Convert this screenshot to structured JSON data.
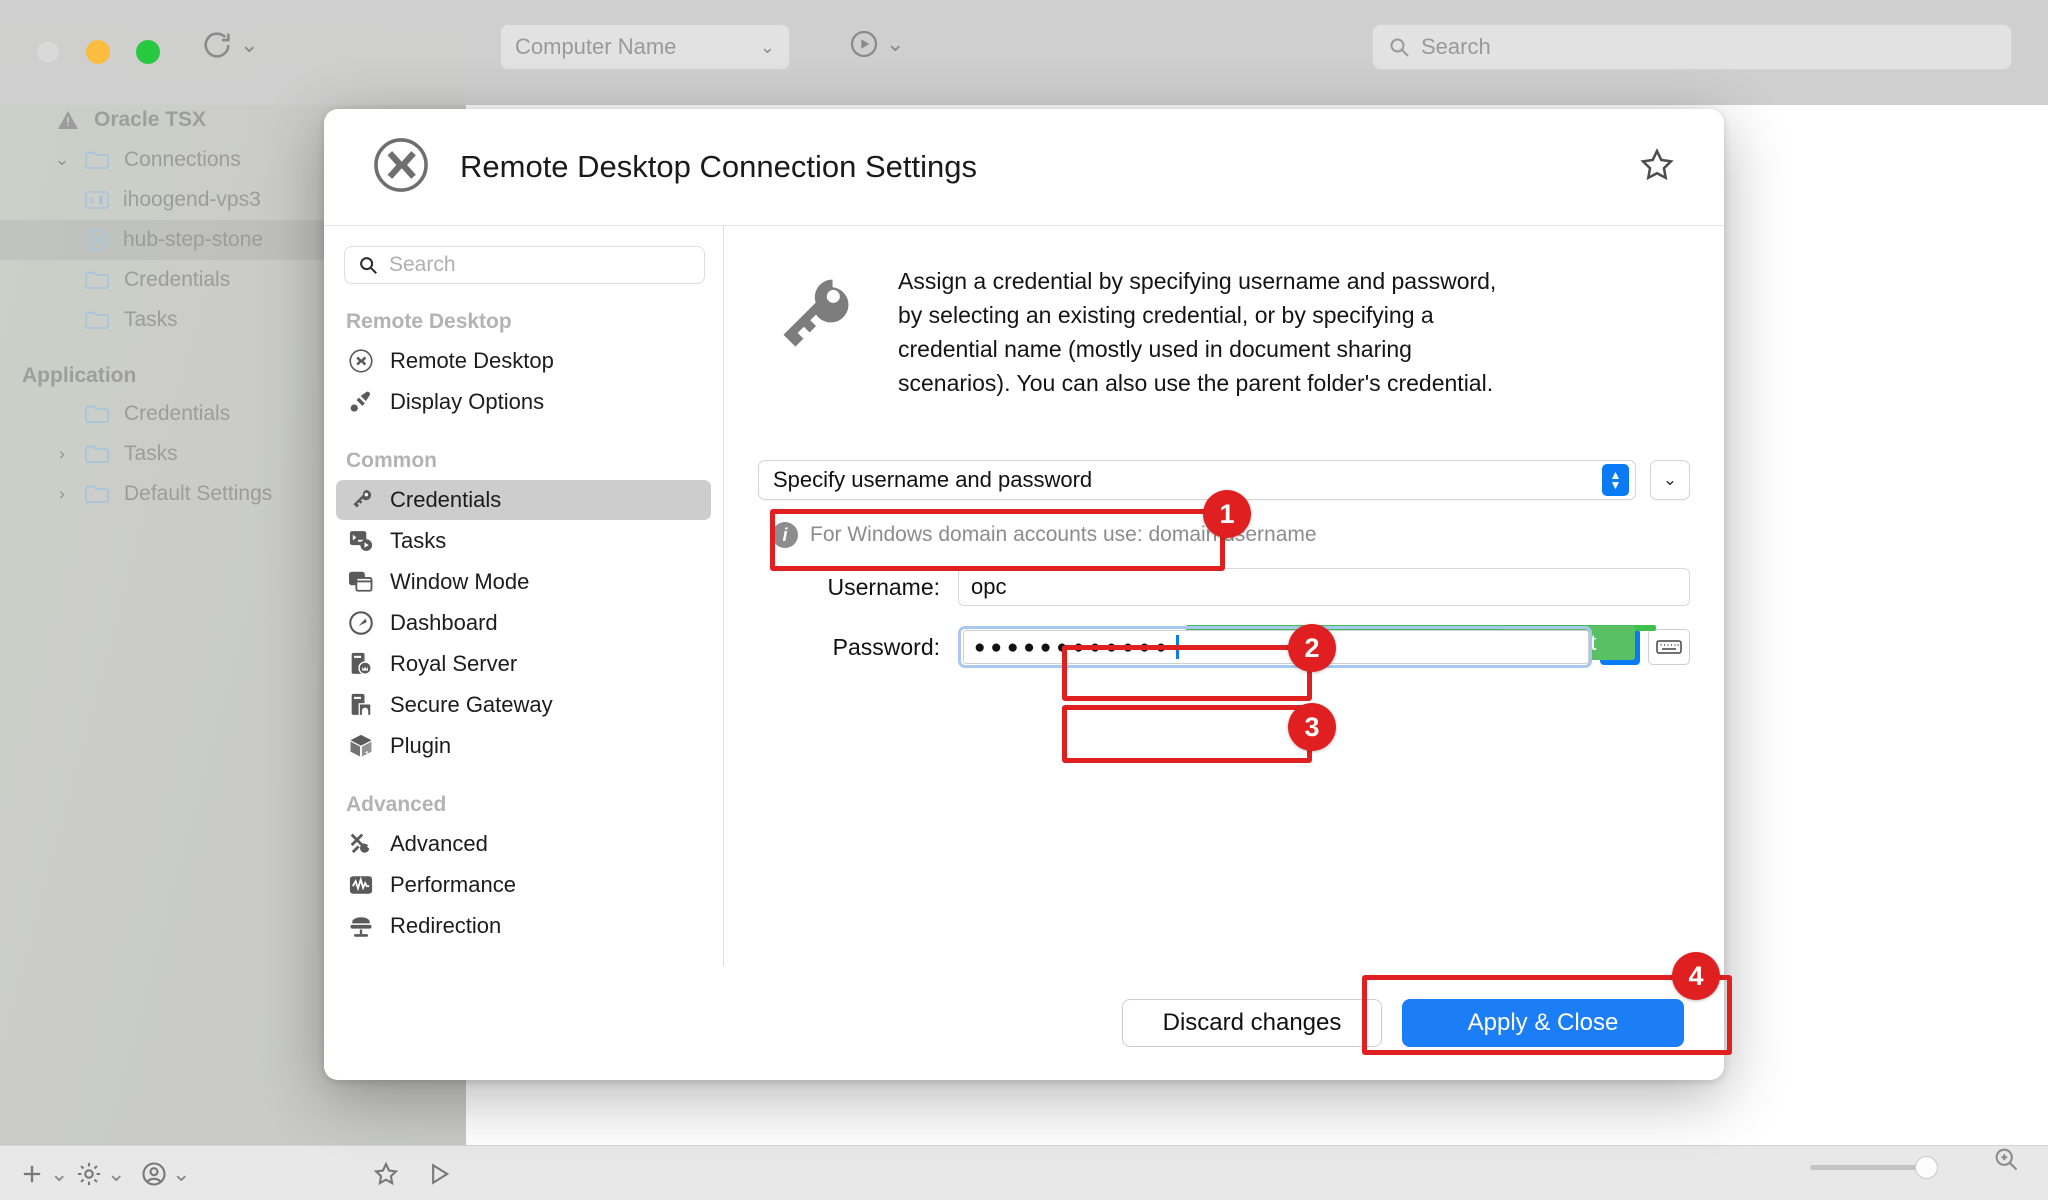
{
  "background_window": {
    "toolbar": {
      "computer_name_placeholder": "Computer Name",
      "search_placeholder": "Search",
      "refresh_icon": "refresh-icon",
      "play_icon": "play-icon",
      "chevron_icon": "chevron-down-icon",
      "search_icon": "search-icon"
    },
    "tree": {
      "root_label": "Oracle TSX",
      "root_icon": "warning-triangle-icon",
      "items": [
        {
          "label": "Connections",
          "icon": "folder-icon",
          "indent": 1,
          "disclosure": "open",
          "selected": false
        },
        {
          "label": "ihoogend-vps3",
          "icon": "terminal-icon",
          "indent": 2,
          "disclosure": "",
          "selected": false
        },
        {
          "label": "hub-step-stone",
          "icon": "rdp-icon",
          "indent": 2,
          "disclosure": "",
          "selected": true
        },
        {
          "label": "Credentials",
          "icon": "folder-icon",
          "indent": 1,
          "disclosure": "",
          "selected": false
        },
        {
          "label": "Tasks",
          "icon": "folder-icon",
          "indent": 1,
          "disclosure": "",
          "selected": false
        }
      ],
      "section_label": "Application",
      "app_items": [
        {
          "label": "Credentials",
          "icon": "folder-icon",
          "indent": 1,
          "disclosure": "",
          "selected": false
        },
        {
          "label": "Tasks",
          "icon": "folder-icon",
          "indent": 1,
          "disclosure": "closed",
          "selected": false
        },
        {
          "label": "Default Settings",
          "icon": "folder-icon",
          "indent": 1,
          "disclosure": "closed",
          "selected": false
        }
      ]
    },
    "bottom_bar": {
      "add_icon": "plus-icon",
      "gear_icon": "gear-icon",
      "account_icon": "user-icon",
      "star_icon": "star-icon",
      "play_icon": "play-triangle-icon",
      "zoom_icon": "zoom-magnifier-icon"
    }
  },
  "dialog": {
    "title": "Remote Desktop Connection Settings",
    "app_icon": "rdp-icon",
    "favorite_icon": "star-outline-icon",
    "nav": {
      "search_placeholder": "Search",
      "search_icon": "search-icon",
      "sections": [
        {
          "label": "Remote Desktop",
          "items": [
            {
              "label": "Remote Desktop",
              "icon": "rdp-icon",
              "active": false
            },
            {
              "label": "Display Options",
              "icon": "paint-brush-icon",
              "active": false
            }
          ]
        },
        {
          "label": "Common",
          "items": [
            {
              "label": "Credentials",
              "icon": "key-icon",
              "active": true
            },
            {
              "label": "Tasks",
              "icon": "tasks-icon",
              "active": false
            },
            {
              "label": "Window Mode",
              "icon": "windows-icon",
              "active": false
            },
            {
              "label": "Dashboard",
              "icon": "gauge-icon",
              "active": false
            },
            {
              "label": "Royal Server",
              "icon": "server-crown-icon",
              "active": false
            },
            {
              "label": "Secure Gateway",
              "icon": "server-tunnel-icon",
              "active": false
            },
            {
              "label": "Plugin",
              "icon": "cube-icon",
              "active": false
            }
          ]
        },
        {
          "label": "Advanced",
          "items": [
            {
              "label": "Advanced",
              "icon": "tools-icon",
              "active": false
            },
            {
              "label": "Performance",
              "icon": "pulse-icon",
              "active": false
            },
            {
              "label": "Redirection",
              "icon": "redirection-icon",
              "active": false
            }
          ]
        }
      ]
    },
    "main": {
      "hero_icon": "key-icon",
      "description": "Assign a credential by specifying username and password, by selecting an existing credential, or by specifying a credential name (mostly used in document sharing scenarios). You can also use the parent folder's credential.",
      "credential_mode": "Specify username and password",
      "credential_mode_stepper_icon": "stepper-updown-icon",
      "credential_more_icon": "chevron-down-icon",
      "hint_icon": "info-icon",
      "hint": "For Windows domain accounts use: domain\\username",
      "username_label": "Username:",
      "username_value": "opc",
      "password_label": "Password:",
      "password_masked": "●●●●●●●●●●●●",
      "password_strength_label": "Great",
      "password_reveal_icon": "dot-icon",
      "password_keyboard_icon": "keyboard-icon"
    },
    "footer": {
      "discard_label": "Discard changes",
      "apply_label": "Apply & Close"
    }
  },
  "annotations": [
    {
      "number": "1",
      "target": "credential-mode-dropdown"
    },
    {
      "number": "2",
      "target": "username-field"
    },
    {
      "number": "3",
      "target": "password-field"
    },
    {
      "number": "4",
      "target": "apply-close-button"
    }
  ],
  "colors": {
    "annotation_red": "#e02020",
    "primary_blue": "#1b7ef7",
    "strength_green": "#59c163"
  }
}
